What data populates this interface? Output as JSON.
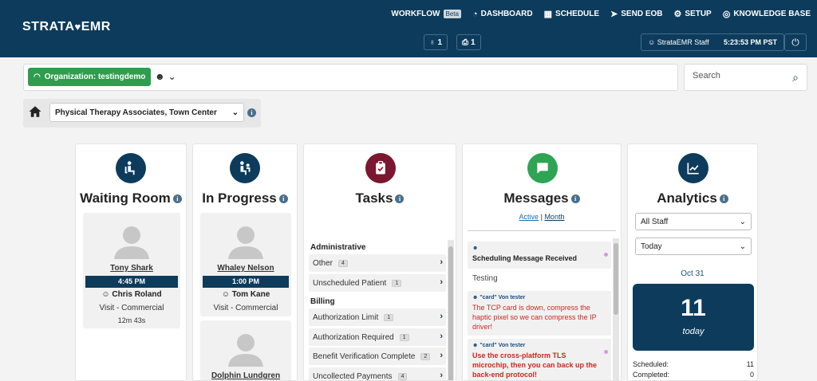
{
  "header": {
    "logo_text": "STRATA",
    "logo_suffix": "EMR",
    "workflow_label": "WORKFLOW",
    "beta_badge": "Beta",
    "nav": {
      "dashboard": "DASHBOARD",
      "schedule": "SCHEDULE",
      "send_eob": "SEND EOB",
      "setup": "SETUP",
      "knowledge_base": "KNOWLEDGE BASE"
    },
    "counter_waiting": "1",
    "counter_print": "1",
    "user_name": "StrataEMR Staff",
    "time": "5:23:53 PM PST"
  },
  "org_bar": {
    "org_label": "Organization: testingdemo"
  },
  "search": {
    "placeholder": "Search"
  },
  "location": {
    "selected": "Physical Therapy Associates, Town Center"
  },
  "columns": {
    "waiting_room": {
      "title": "Waiting Room",
      "patients": [
        {
          "name": "Tony Shark",
          "time": "4:45 PM",
          "provider": "Chris Roland",
          "visit": "Visit - Commercial",
          "elapsed": "12m 43s"
        }
      ]
    },
    "in_progress": {
      "title": "In Progress",
      "patients": [
        {
          "name": "Whaley Nelson",
          "time": "1:00 PM",
          "provider": "Tom Kane",
          "visit": "Visit - Commercial"
        },
        {
          "name": "Dolphin Lundgren"
        }
      ]
    },
    "tasks": {
      "title": "Tasks",
      "sections": [
        {
          "label": "Administrative",
          "items": [
            {
              "label": "Other",
              "count": "4"
            },
            {
              "label": "Unscheduled Patient",
              "count": "1"
            }
          ]
        },
        {
          "label": "Billing",
          "items": [
            {
              "label": "Authorization Limit",
              "count": "1"
            },
            {
              "label": "Authorization Required",
              "count": "1"
            },
            {
              "label": "Benefit Verification Complete",
              "count": "2"
            },
            {
              "label": "Uncollected Payments",
              "count": "4"
            }
          ]
        }
      ]
    },
    "messages": {
      "title": "Messages",
      "tab_active": "Active",
      "tab_separator": "|",
      "tab_month": "Month",
      "items": [
        {
          "title": "Scheduling Message Received"
        },
        {
          "text": "Testing"
        },
        {
          "sender": "\"card\" Von tester",
          "body": "The TCP card is down, compress the haptic pixel so we can compress the IP driver!"
        },
        {
          "sender": "\"card\" Von tester",
          "body": "Use the cross-platform TLS microchip, then you can back up the back-end protocol!"
        }
      ]
    },
    "analytics": {
      "title": "Analytics",
      "staff_filter": "All Staff",
      "period_filter": "Today",
      "date": "Oct 31",
      "count": "11",
      "count_label": "today",
      "stats": [
        {
          "label": "Scheduled:",
          "value": "11"
        },
        {
          "label": "Completed:",
          "value": "0"
        }
      ]
    }
  },
  "colors": {
    "navy": "#0d3b5c",
    "green": "#2e9d4e",
    "tasks_maroon": "#7b1730",
    "messages_green": "#2ea454",
    "message_red": "#c8291f"
  }
}
